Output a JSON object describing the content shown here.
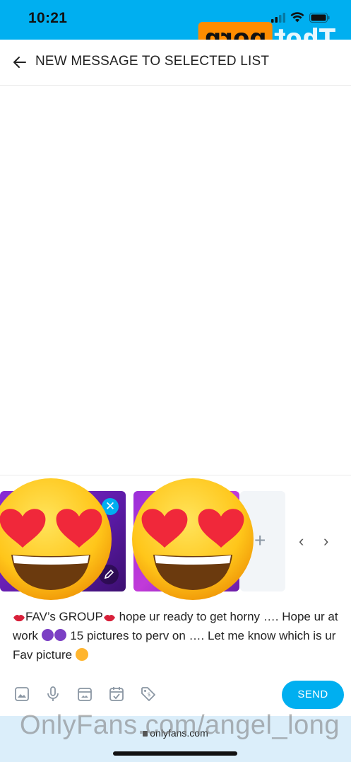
{
  "status_bar": {
    "time": "10:21"
  },
  "watermark": {
    "logo_box": "porn",
    "logo_text": "Thot",
    "url": "OnlyFans.com/angel_long"
  },
  "header": {
    "title": "NEW MESSAGE TO SELECTED LIST",
    "back_icon": "arrow-left-icon"
  },
  "media": {
    "add_icon": "plus-icon",
    "prev_icon": "chevron-left-icon",
    "next_icon": "chevron-right-icon"
  },
  "message": {
    "part1": "FAV’s GROUP",
    "part2": " hope ur ready to get horny …. Hope ur at work ",
    "part3": " 15 pictures to perv on …. Let me know which is ur Fav picture "
  },
  "toolbar": {
    "icons": [
      "image-icon",
      "microphone-icon",
      "gallery-icon",
      "calendar-check-icon",
      "price-tag-icon"
    ],
    "send_label": "SEND"
  },
  "browser": {
    "url": "onlyfans.com"
  },
  "colors": {
    "accent": "#00aff0",
    "status_bg": "#00aff0",
    "bottom_bg": "#dbeefa"
  }
}
